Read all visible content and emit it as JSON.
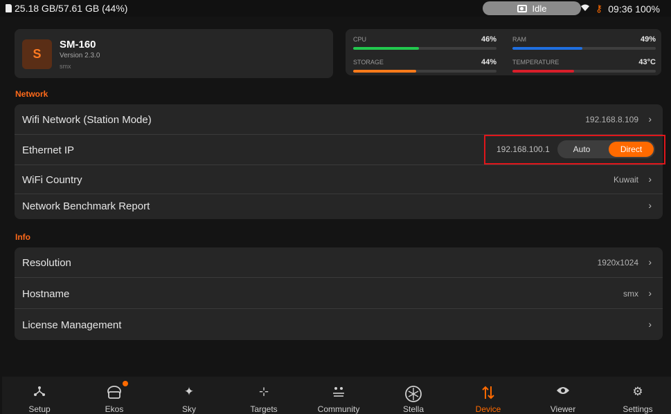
{
  "status_bar": {
    "storage": "25.18 GB/57.61 GB (44%)",
    "center_status": "Idle",
    "time_battery": "09:36 100%",
    "icons": [
      "sd-card-icon",
      "camera-icon",
      "wifi-icon",
      "key-icon"
    ]
  },
  "device": {
    "initial": "S",
    "name": "SM-160",
    "version": "Version 2.3.0",
    "user": "smx"
  },
  "stats": [
    {
      "label": "CPU",
      "value": "46%",
      "fill": 0.46,
      "color": "#22c94e"
    },
    {
      "label": "RAM",
      "value": "49%",
      "fill": 0.49,
      "color": "#1f6fe0"
    },
    {
      "label": "STORAGE",
      "value": "44%",
      "fill": 0.44,
      "color": "#ff7a1a"
    },
    {
      "label": "TEMPERATURE",
      "value": "43°C",
      "fill": 0.43,
      "color": "#d81e2a"
    }
  ],
  "network": {
    "title": "Network",
    "rows": [
      {
        "label": "Wifi Network (Station Mode)",
        "value": "192.168.8.109"
      },
      {
        "label": "Ethernet IP",
        "value": "192.168.100.1",
        "toggle": {
          "options": [
            "Auto",
            "Direct"
          ],
          "selected": "Direct"
        }
      },
      {
        "label": "WiFi Country",
        "value": "Kuwait"
      },
      {
        "label": "Network Benchmark Report",
        "value": ""
      }
    ]
  },
  "info": {
    "title": "Info",
    "rows": [
      {
        "label": "Resolution",
        "value": "1920x1024"
      },
      {
        "label": "Hostname",
        "value": "smx"
      },
      {
        "label": "License Management",
        "value": ""
      }
    ]
  },
  "nav": {
    "active": "Device",
    "items": [
      {
        "label": "Setup",
        "icon": "setup-icon"
      },
      {
        "label": "Ekos",
        "icon": "ekos-icon",
        "badge": true
      },
      {
        "label": "Sky",
        "icon": "sky-icon"
      },
      {
        "label": "Targets",
        "icon": "targets-icon"
      },
      {
        "label": "Community",
        "icon": "community-icon"
      },
      {
        "label": "Stella",
        "icon": "stella-icon"
      },
      {
        "label": "Device",
        "icon": "device-icon"
      },
      {
        "label": "Viewer",
        "icon": "viewer-icon"
      },
      {
        "label": "Settings",
        "icon": "settings-icon"
      }
    ]
  },
  "chevron": "›"
}
